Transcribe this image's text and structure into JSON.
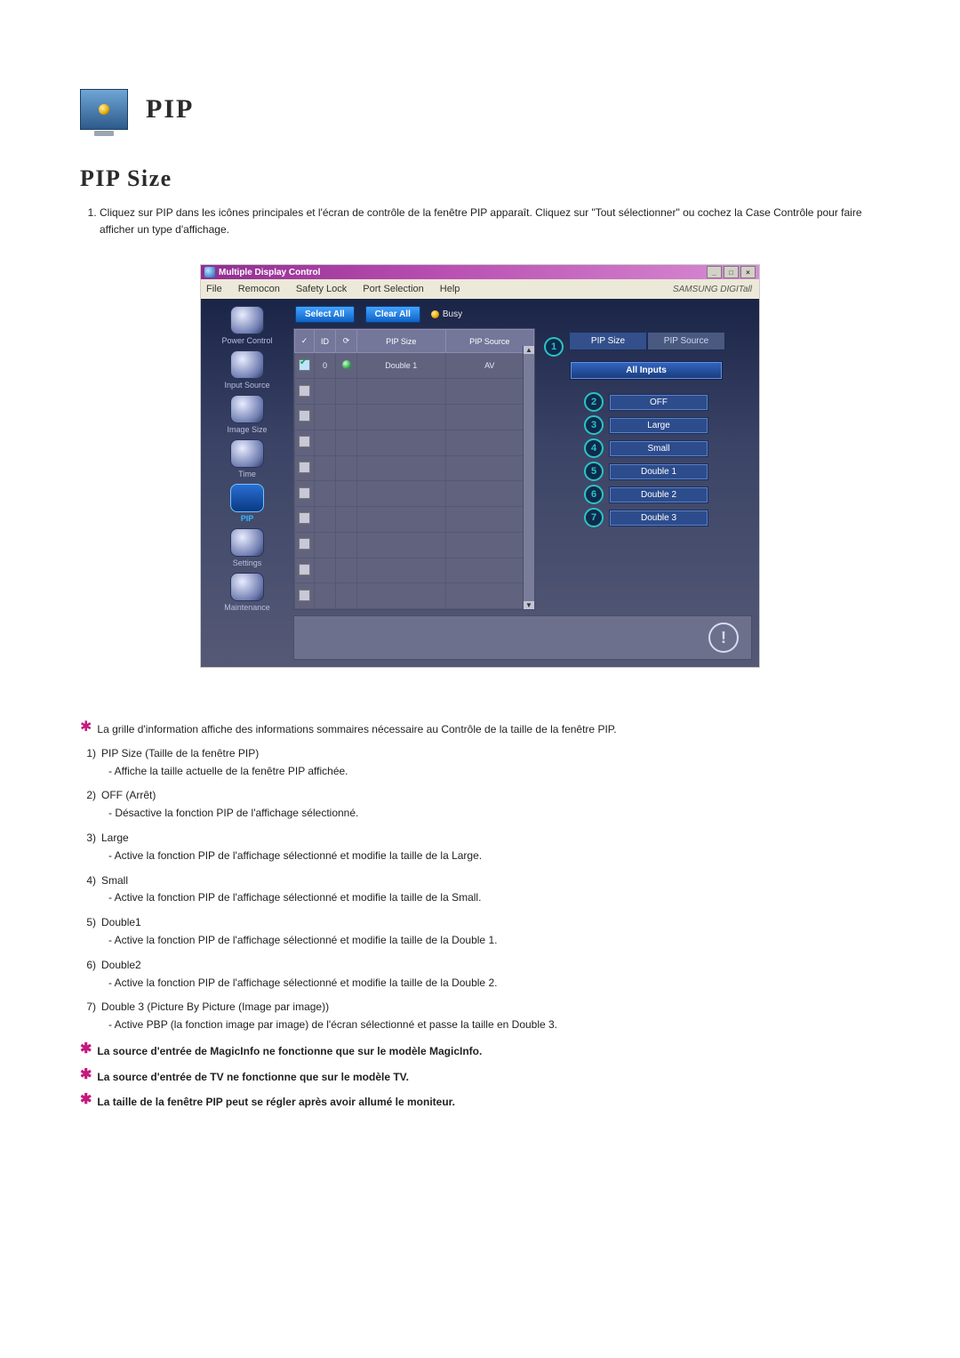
{
  "title": "PIP",
  "h2": "PIP Size",
  "intro": [
    "Cliquez sur PIP dans les icônes principales et l'écran de contrôle de la fenêtre PIP apparaît. Cliquez sur \"Tout sélectionner\" ou cochez la Case Contrôle pour faire afficher un type d'affichage."
  ],
  "screenshot": {
    "window_title": "Multiple Display Control",
    "menu": [
      "File",
      "Remocon",
      "Safety Lock",
      "Port Selection",
      "Help"
    ],
    "brand": "SAMSUNG DIGITall",
    "sidebar": [
      {
        "label": "Power Control"
      },
      {
        "label": "Input Source"
      },
      {
        "label": "Image Size"
      },
      {
        "label": "Time"
      },
      {
        "label": "PIP",
        "active": true
      },
      {
        "label": "Settings"
      },
      {
        "label": "Maintenance"
      }
    ],
    "toolbar": {
      "select_all": "Select All",
      "clear_all": "Clear All",
      "busy": "Busy"
    },
    "grid": {
      "headers": {
        "check": "✓",
        "id": "ID",
        "status": "⟳",
        "size": "PIP Size",
        "source": "PIP Source"
      },
      "row": {
        "id": "0",
        "size": "Double 1",
        "source": "AV"
      },
      "blank_rows": 9
    },
    "panel": {
      "tab_active": "PIP Size",
      "tab_inactive": "PIP Source",
      "group": "All Inputs",
      "options": [
        {
          "n": "2",
          "label": "OFF"
        },
        {
          "n": "3",
          "label": "Large"
        },
        {
          "n": "4",
          "label": "Small"
        },
        {
          "n": "5",
          "label": "Double 1"
        },
        {
          "n": "6",
          "label": "Double 2"
        },
        {
          "n": "7",
          "label": "Double 3"
        }
      ],
      "tab_callout": "1"
    }
  },
  "star1": "La grille d'information affiche des informations sommaires nécessaire au Contrôle de la taille de la fenêtre PIP.",
  "items": [
    {
      "n": "1)",
      "title": "PIP Size (Taille de la fenêtre PIP)",
      "sub": "- Affiche la taille actuelle de la fenêtre PIP affichée."
    },
    {
      "n": "2)",
      "title": "OFF (Arrêt)",
      "sub": "- Désactive la fonction PIP de l'affichage sélectionné."
    },
    {
      "n": "3)",
      "title": "Large",
      "sub": "- Active la fonction PIP de l'affichage sélectionné et modifie la taille de la Large."
    },
    {
      "n": "4)",
      "title": "Small",
      "sub": "- Active la fonction PIP de l'affichage sélectionné et modifie la taille de la Small."
    },
    {
      "n": "5)",
      "title": "Double1",
      "sub": "- Active la fonction PIP de l'affichage sélectionné et modifie la taille de la Double 1."
    },
    {
      "n": "6)",
      "title": "Double2",
      "sub": "- Active la fonction PIP de l'affichage sélectionné et modifie la taille de la Double 2."
    },
    {
      "n": "7)",
      "title": "Double 3 (Picture By Picture (Image par image))",
      "sub": "- Active PBP (la fonction image par image) de l'écran sélectionné et passe la taille en Double 3."
    }
  ],
  "bold_notes": [
    "La source d'entrée de MagicInfo ne fonctionne que sur le modèle MagicInfo.",
    "La source d'entrée de TV ne fonctionne que sur le modèle TV.",
    "La taille de la fenêtre PIP peut se régler après avoir allumé le moniteur."
  ]
}
